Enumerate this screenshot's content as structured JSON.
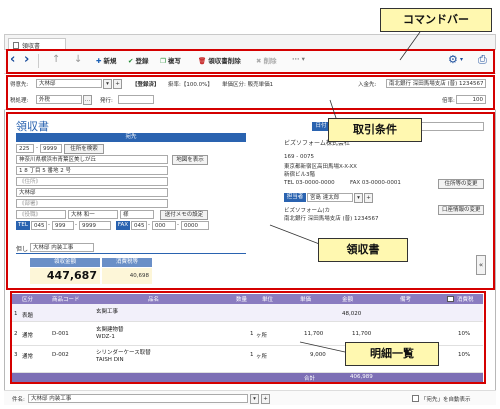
{
  "tab": {
    "label": "領収書"
  },
  "toolbar": {
    "new": "新規",
    "register": "登録",
    "copy": "複写",
    "delete_receipt": "領収書削除",
    "delete": "削除",
    "more": "···"
  },
  "conditions": {
    "customer_label": "得意先:",
    "customer_value": "大林邸",
    "registered_badge": "【登録済】",
    "tax_rate": "掛率:【100.0%】",
    "price_class": "単価区分: 販売単価1",
    "deposit_label": "入金先:",
    "deposit_value": "南北銀行 深田馬場支店 (普) 1234567",
    "tax_label": "税処理:",
    "tax_value": "外税",
    "issue_label": "発行:",
    "issue_value": "",
    "multiplier_label": "倍率:",
    "multiplier_value": "100"
  },
  "receipt": {
    "title": "領収書",
    "to_header": "宛先",
    "zip1": "225",
    "zip2": "9999",
    "address_search": "住所を検索",
    "address1": "神奈川県横浜市青葉区美しが丘",
    "address2": "1 8 丁目 5 番地 2 号",
    "address3_placeholder": "《住所》",
    "company": "大林邸",
    "dept_placeholder": "《部署》",
    "position_placeholder": "《役職》",
    "person": "大林 和一",
    "honorific": "様",
    "map_button": "地図を表示",
    "memo_button": "送付メモの設定",
    "tel_label": "TEL",
    "tel1": "045",
    "tel2": "999",
    "tel3": "9999",
    "fax_label": "FAX",
    "fax1": "045",
    "fax2": "000",
    "fax3": "0000",
    "but_label": "但し",
    "but_value": "大林邸 内装工事",
    "amount_header": "領収金額",
    "tax_header": "消費税等",
    "amount": "447,687",
    "tax": "40,698",
    "date_label": "日付",
    "issuer_name": "ビズソフォーム株式会社",
    "issuer_zip": "169 - 0075",
    "issuer_addr1": "東京都新宿区高田馬場X-X-XX",
    "issuer_addr2": "新宿ビル3階",
    "issuer_tel": "TEL 03-0000-0000",
    "issuer_fax": "FAX 03-0000-0001",
    "change_addr_button": "住所等の変更",
    "staff_label": "担当者",
    "staff_value": "宮島 達太郎",
    "bank_name": "ビズソフォーム(カ",
    "bank_detail": "南北銀行 深田馬場支店 (普) 1234567",
    "change_bank_button": "口座情報の変更"
  },
  "table": {
    "headers": [
      "区分",
      "商品コード",
      "品名",
      "数量",
      "単位",
      "単価",
      "金額",
      "備考",
      "消費税"
    ],
    "rows": [
      {
        "no": "1",
        "kind": "表題",
        "code": "",
        "name": "玄関工事",
        "name2": "",
        "qty": "",
        "unit": "",
        "price": "",
        "amount": "48,020",
        "note": "",
        "tax": ""
      },
      {
        "no": "2",
        "kind": "通常",
        "code": "D-001",
        "name": "玄関建物替",
        "name2": "WDZ-1",
        "qty": "1",
        "unit": "ヶ所",
        "price": "11,700",
        "amount": "11,700",
        "note": "",
        "tax": "10%"
      },
      {
        "no": "3",
        "kind": "通常",
        "code": "D-002",
        "name": "シリンダーケース取替",
        "name2": "TAISH DIN",
        "qty": "1",
        "unit": "ヶ所",
        "price": "9,000",
        "amount": "9,000",
        "note": "",
        "tax": "10%"
      }
    ],
    "total_label": "合計",
    "total_value": "406,989"
  },
  "bottom": {
    "subject_label": "件名:",
    "subject_value": "大林邸 内装工事",
    "auto_label": "「宛先」を自動表示"
  },
  "callouts": {
    "command_bar": "コマンドバー",
    "conditions": "取引条件",
    "receipt": "領収書",
    "details": "明細一覧"
  }
}
